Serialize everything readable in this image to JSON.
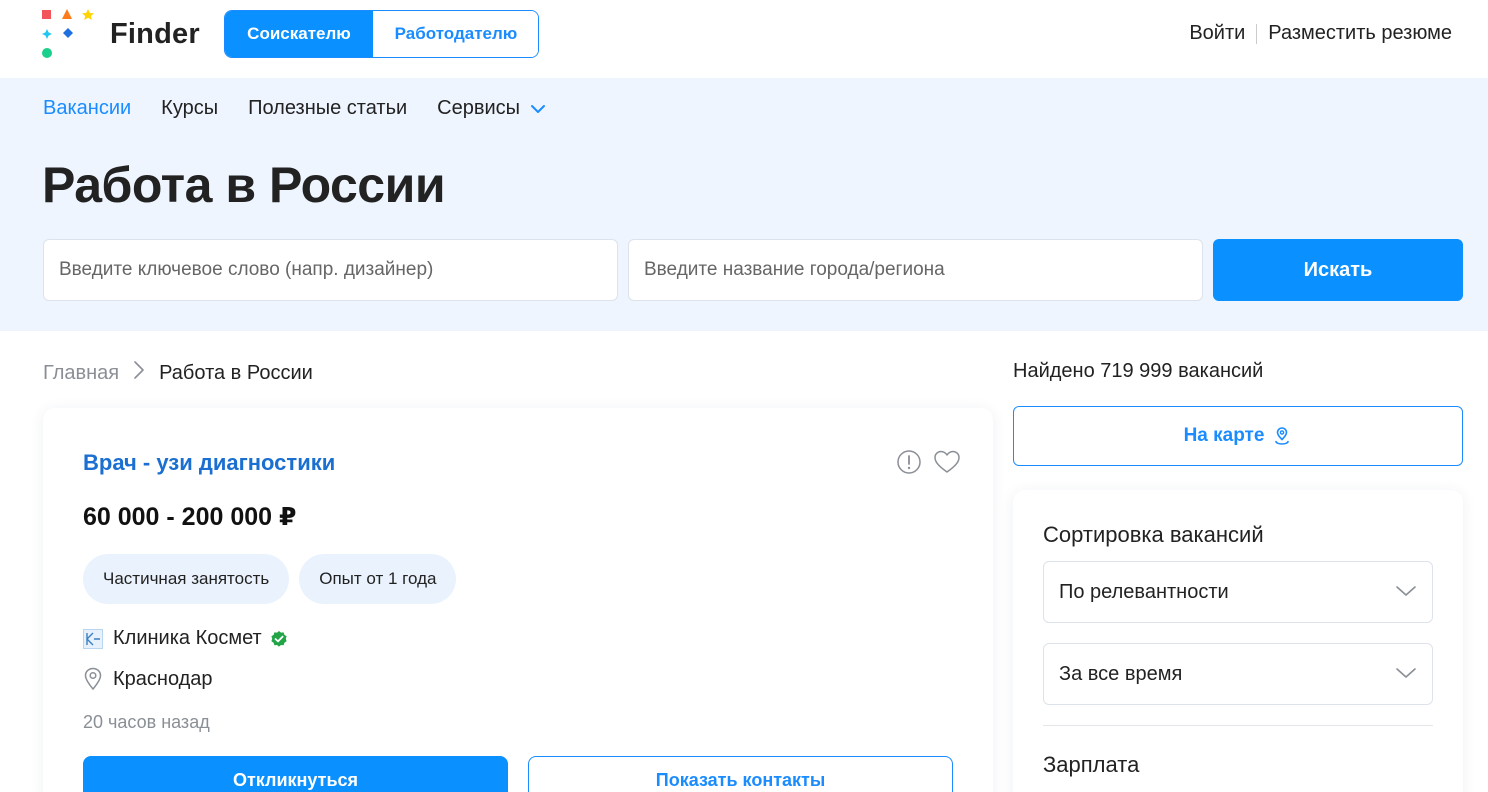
{
  "header": {
    "logo_text": "Finder",
    "roles": [
      "Соискателю",
      "Работодателю"
    ],
    "login": "Войти",
    "post_resume": "Разместить резюме"
  },
  "nav": {
    "items": [
      "Вакансии",
      "Курсы",
      "Полезные статьи",
      "Сервисы"
    ],
    "active": "Вакансии"
  },
  "hero": {
    "title": "Работа в России",
    "keyword_placeholder": "Введите ключевое слово (напр. дизайнер)",
    "city_placeholder": "Введите название города/региона",
    "search_label": "Искать"
  },
  "breadcrumb": {
    "home": "Главная",
    "current": "Работа в России"
  },
  "vacancy": {
    "title": "Врач - узи диагностики",
    "salary": "60 000 - 200 000 ₽",
    "tags": [
      "Частичная занятость",
      "Опыт от 1 года"
    ],
    "company": "Клиника Космет",
    "location": "Краснодар",
    "posted": "20 часов назад",
    "apply_label": "Откликнуться",
    "contacts_label": "Показать контакты"
  },
  "sidebar": {
    "found": "Найдено 719 999 вакансий",
    "map_label": "На карте",
    "sort_title": "Сортировка вакансий",
    "sort_value": "По релевантности",
    "period_value": "За все время",
    "salary_title": "Зарплата"
  },
  "colors": {
    "accent": "#0a90ff",
    "link": "#1a6fd1",
    "hero_bg": "#eef5fe",
    "tag_bg": "#eaf3fd",
    "verified": "#22a447"
  },
  "icons": [
    "finder-logo",
    "chevron-down-icon",
    "chevron-right-icon",
    "report-icon",
    "heart-icon",
    "verified-icon",
    "location-pin-icon",
    "map-pin-icon"
  ]
}
